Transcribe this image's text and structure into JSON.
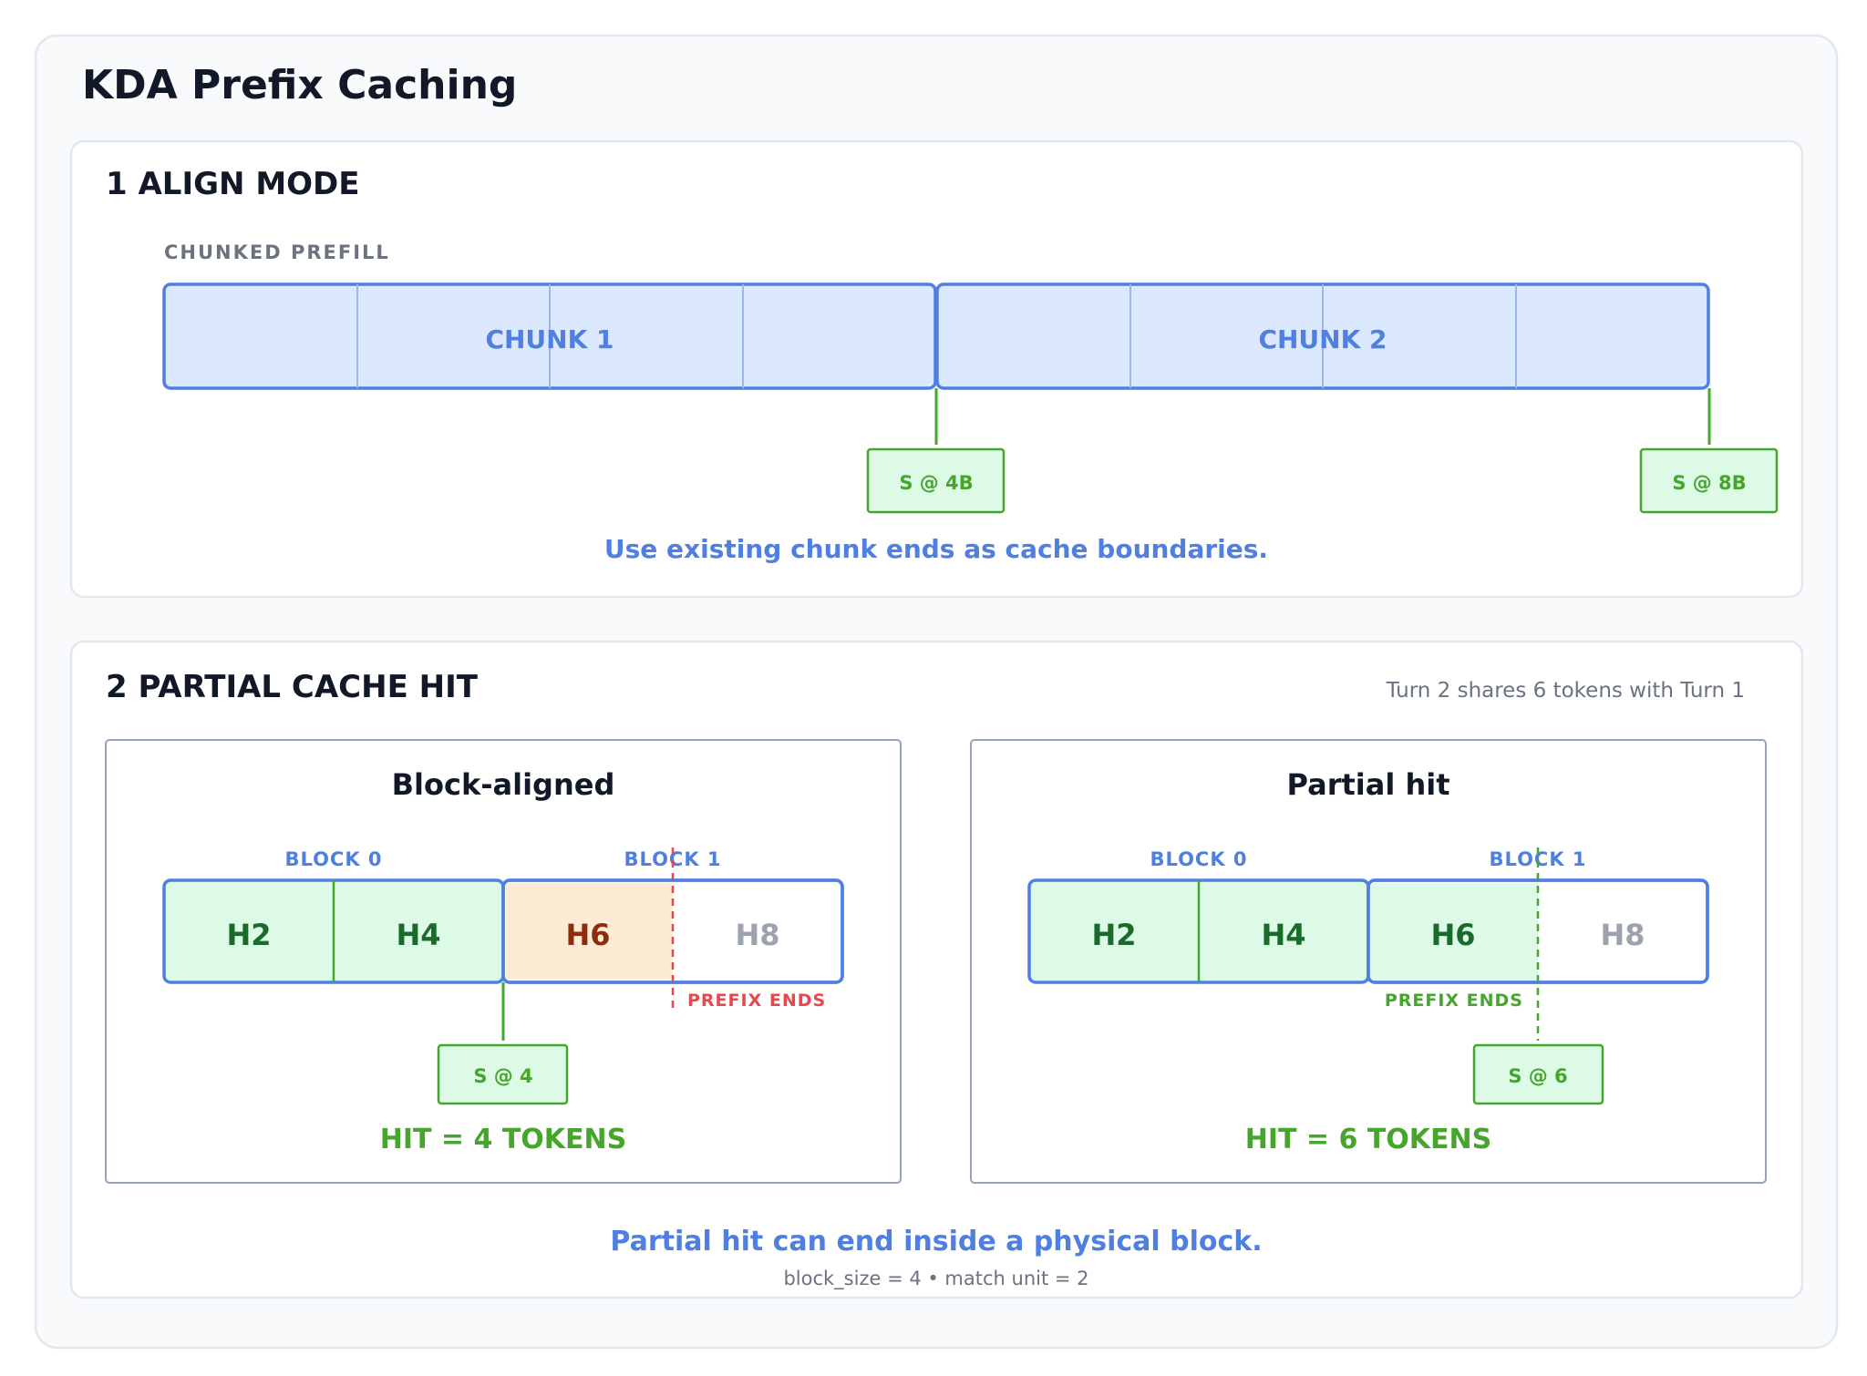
{
  "title": "KDA Prefix Caching",
  "colors": {
    "blue": "#4f7fe0",
    "blue_fill": "#dbe8fd",
    "green": "#45a52c",
    "green_fill": "#dcfae6",
    "green_text": "#1a6a2c",
    "orange_fill": "#feebd6",
    "orange_text": "#8b2e0f",
    "red": "#e5484d",
    "gray_text": "#9ca3af",
    "dark": "#111827"
  },
  "section1": {
    "heading": "1 ALIGN MODE",
    "track_label": "CHUNKED PREFILL",
    "chunk1": "CHUNK 1",
    "chunk2": "CHUNK 2",
    "state1": "S @ 4B",
    "state2": "S @ 8B",
    "caption": "Use existing chunk ends as cache boundaries."
  },
  "section2": {
    "heading": "2 PARTIAL CACHE HIT",
    "note": "Turn 2 shares 6 tokens with Turn 1",
    "left": {
      "title": "Block-aligned",
      "block0": "BLOCK 0",
      "block1": "BLOCK 1",
      "tokens": [
        "H2",
        "H4",
        "H6",
        "H8"
      ],
      "prefix_ends": "PREFIX ENDS",
      "state": "S @ 4",
      "hit": "HIT = 4 TOKENS"
    },
    "right": {
      "title": "Partial hit",
      "block0": "BLOCK 0",
      "block1": "BLOCK 1",
      "tokens": [
        "H2",
        "H4",
        "H6",
        "H8"
      ],
      "prefix_ends": "PREFIX ENDS",
      "state": "S @ 6",
      "hit": "HIT = 6 TOKENS"
    },
    "caption": "Partial hit can end inside a physical block.",
    "footnote": "block_size = 4 • match unit = 2"
  }
}
